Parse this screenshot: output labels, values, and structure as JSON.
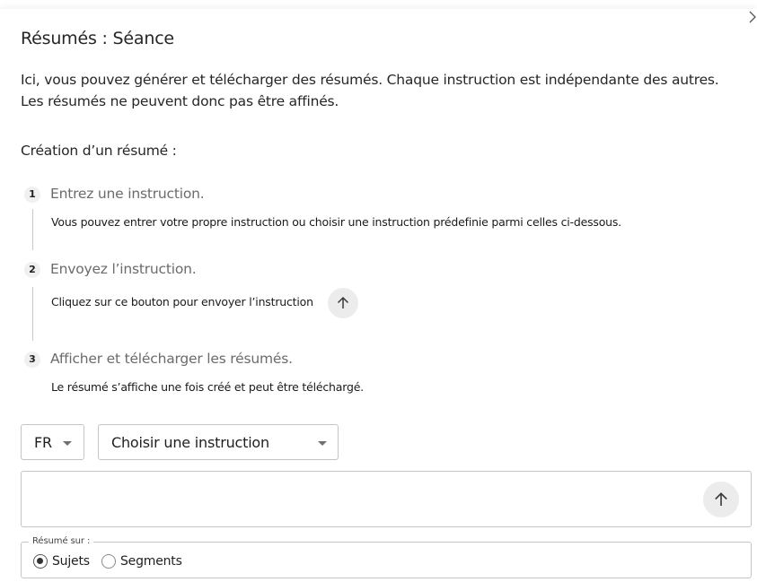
{
  "dialog": {
    "title": "Résumés : Séance",
    "close_icon": "chevron-right-icon",
    "intro": "Ici, vous pouvez générer et télécharger des résumés. Chaque instruction est indépendante des autres. Les résumés ne peuvent donc pas être affinés."
  },
  "creation": {
    "heading": "Création d’un résumé :",
    "steps": [
      {
        "number": "1",
        "title": "Entrez une instruction.",
        "description": "Vous pouvez entrer votre propre instruction ou choisir une instruction prédefinie parmi celles ci-dessous."
      },
      {
        "number": "2",
        "title": "Envoyez l’instruction.",
        "description": "Cliquez sur ce bouton pour envoyer l’instruction"
      },
      {
        "number": "3",
        "title": "Afficher et télécharger les résumés.",
        "description": "Le résumé s’affiche une fois créé et peut être téléchargé."
      }
    ]
  },
  "controls": {
    "language_select": {
      "value": "FR"
    },
    "instruction_select": {
      "value": "Choisir une instruction"
    },
    "instruction_input": {
      "value": "",
      "placeholder": ""
    },
    "send_icon": "arrow-up-icon"
  },
  "summary_on": {
    "legend": "Résumé sur :",
    "options": [
      {
        "label": "Sujets",
        "checked": true
      },
      {
        "label": "Segments",
        "checked": false
      }
    ]
  }
}
